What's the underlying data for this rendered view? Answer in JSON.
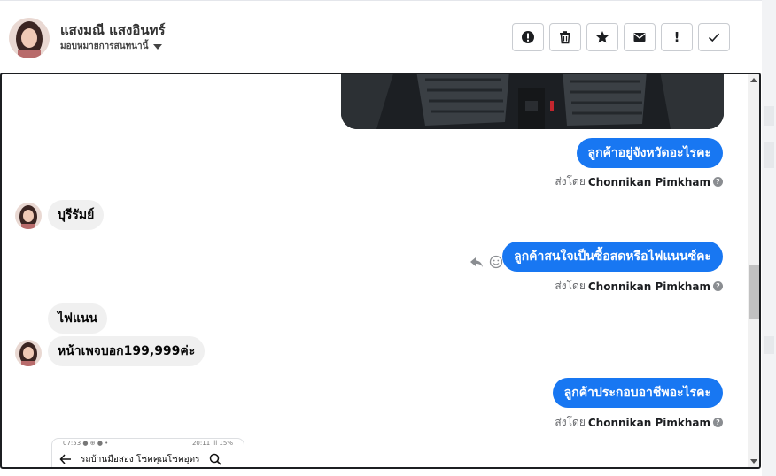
{
  "contact": {
    "name": "แสงมณี แสงอินทร์",
    "assign_label": "มอบหมายการสนทนานี้"
  },
  "toolbar": {
    "buttons": [
      {
        "name": "alert-circle-icon"
      },
      {
        "name": "trash-icon"
      },
      {
        "name": "star-icon"
      },
      {
        "name": "envelope-icon"
      },
      {
        "name": "exclamation-icon",
        "label": "!"
      },
      {
        "name": "check-icon"
      }
    ]
  },
  "messages": {
    "m1": {
      "text": "ลูกค้าอยู่จังหวัดอะไรคะ",
      "sent_by_prefix": "ส่งโดย",
      "sent_by_name": "Chonnikan Pimkham"
    },
    "m2": {
      "text": "บุรีรัมย์"
    },
    "m3": {
      "text": "ลูกค้าสนใจเป็นซื้อสดหรือไฟแนนซ์คะ",
      "sent_by_prefix": "ส่งโดย",
      "sent_by_name": "Chonnikan Pimkham"
    },
    "m4": {
      "text": "ไฟแนน"
    },
    "m5": {
      "text": "หน้าเพจบอก199,999ค่ะ"
    },
    "m6": {
      "text": "ลูกค้าประกอบอาชีพอะไรคะ",
      "sent_by_prefix": "ส่งโดย",
      "sent_by_name": "Chonnikan Pimkham"
    }
  },
  "shared_screenshot": {
    "status_left": "07:53 ● ⊕ ● •",
    "status_right": "20:11 ıll 15%",
    "search_text": "รถบ้านมือสอง โชคคุณโชคอุดร"
  },
  "colors": {
    "accent": "#1877f2",
    "incoming_bubble": "#f0f0f0",
    "text_muted": "#65676b"
  }
}
